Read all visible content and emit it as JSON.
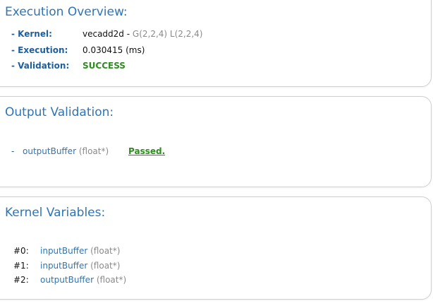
{
  "execution": {
    "title": "Execution Overview:",
    "kernel_label": "- Kernel:",
    "kernel_name": "vecadd2d",
    "kernel_sep": " - ",
    "kernel_dims": "G(2,2,4) L(2,2,4)",
    "exec_label": "- Execution:",
    "exec_value": "0.030415 (ms)",
    "valid_label": "- Validation:",
    "valid_value": "SUCCESS"
  },
  "validation": {
    "title": "Output Validation:",
    "items": [
      {
        "dash": "-",
        "name": "outputBuffer",
        "type": "(float*)",
        "status": "Passed."
      }
    ]
  },
  "variables": {
    "title": "Kernel Variables:",
    "items": [
      {
        "index": "#0:",
        "name": "inputBuffer",
        "type": "(float*)"
      },
      {
        "index": "#1:",
        "name": "inputBuffer",
        "type": "(float*)"
      },
      {
        "index": "#2:",
        "name": "outputBuffer",
        "type": "(float*)"
      }
    ]
  },
  "colors": {
    "title_blue": "#2e75b6",
    "label_blue": "#1f5f9e",
    "success_green": "#2e8b1f"
  }
}
